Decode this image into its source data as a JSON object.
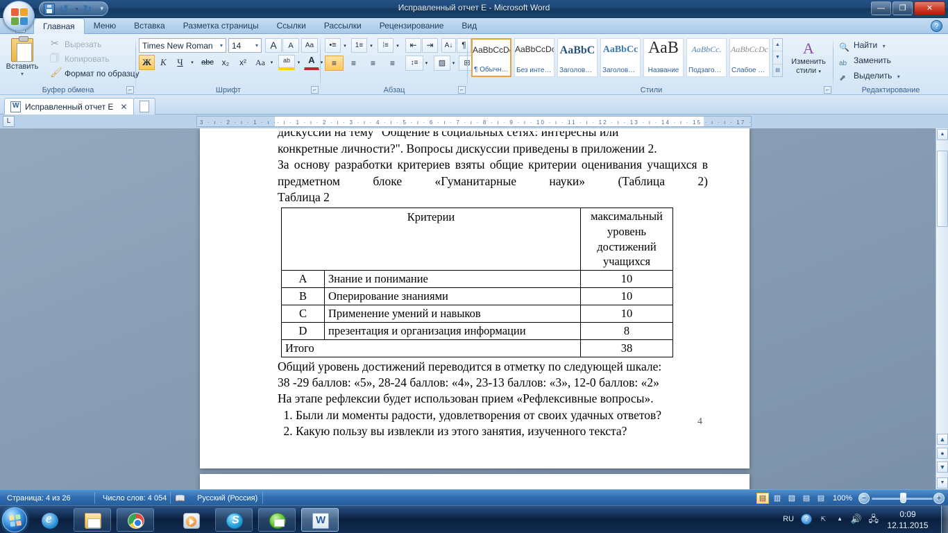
{
  "window": {
    "title": "Исправленный отчет Е - Microsoft Word",
    "minimize": "—",
    "maximize": "❐",
    "close": "✕"
  },
  "quick_access": {
    "save_icon": "save-icon",
    "undo_icon": "undo-icon",
    "redo_icon": "redo-icon",
    "customize_icon": "chevron-down-icon"
  },
  "ribbon": {
    "tabs": [
      {
        "label": "Главная",
        "active": true
      },
      {
        "label": "Меню",
        "active": false
      },
      {
        "label": "Вставка",
        "active": false
      },
      {
        "label": "Разметка страницы",
        "active": false
      },
      {
        "label": "Ссылки",
        "active": false
      },
      {
        "label": "Рассылки",
        "active": false
      },
      {
        "label": "Рецензирование",
        "active": false
      },
      {
        "label": "Вид",
        "active": false
      }
    ],
    "help_label": "?",
    "groups": {
      "clipboard": {
        "label": "Буфер обмена",
        "paste": "Вставить",
        "cut": "Вырезать",
        "copy": "Копировать",
        "format_painter": "Формат по образцу"
      },
      "font": {
        "label": "Шрифт",
        "font_name": "Times New Roman",
        "font_size": "14",
        "grow": "A",
        "shrink": "A",
        "clear_format": "Aa",
        "bold": "Ж",
        "italic": "К",
        "underline": "Ч",
        "strike": "abc",
        "subscript": "x₂",
        "superscript": "x²",
        "change_case": "Aa",
        "highlight": "ab",
        "font_color": "A"
      },
      "paragraph": {
        "label": "Абзац",
        "bullets": "•≡",
        "numbering": "1≡",
        "multilevel": "⁞≡",
        "decrease_indent": "⇤",
        "increase_indent": "⇥",
        "sort": "A↓",
        "show_marks": "¶",
        "align_left": "≡",
        "align_center": "≡",
        "align_right": "≡",
        "justify": "≡",
        "line_spacing": "↕≡",
        "shading": "▨",
        "borders": "⊞"
      },
      "styles": {
        "label": "Стили",
        "items": [
          {
            "sample": "AaBbCcDc",
            "name": "¶ Обычный",
            "selected": true
          },
          {
            "sample": "AaBbCcDc",
            "name": "Без интер…",
            "selected": false
          },
          {
            "sample": "AaBbC",
            "name": "Заголово…",
            "selected": false
          },
          {
            "sample": "AaBbCc",
            "name": "Заголово…",
            "selected": false
          },
          {
            "sample": "АаВ",
            "name": "Название",
            "selected": false
          },
          {
            "sample": "AaBbCc.",
            "name": "Подзагол…",
            "selected": false
          },
          {
            "sample": "AaBbCcDc",
            "name": "Слабое в…",
            "selected": false
          }
        ],
        "change_styles": "Изменить стили"
      },
      "editing": {
        "label": "Редактирование",
        "find": "Найти",
        "replace": "Заменить",
        "select": "Выделить"
      }
    }
  },
  "document_tabs": {
    "active_tab": "Исправленный отчет Е",
    "close_label": "✕"
  },
  "ruler": {
    "left_marks": "3 · ı · 2 · ı · 1 · ı ·",
    "right_marks": "· ı · 1 · ı · 2 · ı · 3 · ı · 4 · ı · 5 · ı · 6 · ı · 7 · ı · 8 · ı · 9 · ı · 10 · ı · 11 · ı · 12 · ı · 13 · ı · 14 · ı · 15 · ı · ı · 17 · ı ·"
  },
  "document": {
    "paragraph_clipped": "дискуссии на тему \"Общение в социальных сетях: интересны или",
    "paragraph_1": "конкретные личности?\". Вопросы дискуссии приведены в приложении 2.",
    "paragraph_2": "За основу разработки критериев взяты общие критерии оценивания учащихся в предметном блоке «Гуманитарные науки» (Таблица 2)",
    "table_caption": "Таблица 2",
    "table": {
      "header": {
        "criteria": "Критерии",
        "max_level": "максимальный уровень достижений учащихся"
      },
      "rows": [
        {
          "letter": "A",
          "criterion": "Знание и понимание",
          "value": "10"
        },
        {
          "letter": "B",
          "criterion": "Оперирование знаниями",
          "value": "10"
        },
        {
          "letter": "C",
          "criterion": "Применение умений и навыков",
          "value": "10"
        },
        {
          "letter": "D",
          "criterion": "презентация и организация информации",
          "value": "8"
        }
      ],
      "total": {
        "label": "Итого",
        "value": "38"
      }
    },
    "paragraph_3": "Общий уровень достижений переводится в отметку по следующей шкале:",
    "paragraph_4": "38 -29 баллов: «5», 28-24 баллов: «4», 23-13 баллов: «3», 12-0 баллов: «2»",
    "paragraph_5": "На этапе рефлексии будет использован прием «Рефлексивные вопросы».",
    "questions": [
      "Были ли моменты радости, удовлетворения от своих удачных ответов?",
      "Какую пользу вы извлекли из этого занятия, изученного текста?"
    ],
    "page_number": "4"
  },
  "status_bar": {
    "page": "Страница: 4 из 26",
    "words": "Число слов: 4 054",
    "proofing_icon": "spellcheck-icon",
    "language": "Русский (Россия)",
    "views": [
      {
        "icon": "print-layout-icon",
        "active": true
      },
      {
        "icon": "full-screen-reading-icon",
        "active": false
      },
      {
        "icon": "web-layout-icon",
        "active": false
      },
      {
        "icon": "outline-icon",
        "active": false
      },
      {
        "icon": "draft-icon",
        "active": false
      }
    ],
    "zoom_level": "100%",
    "zoom_out": "−",
    "zoom_in": "+"
  },
  "taskbar": {
    "start_label": "Пуск",
    "items": [
      {
        "name": "internet-explorer",
        "icon": "ie-icon"
      },
      {
        "name": "windows-explorer",
        "icon": "folder-icon"
      },
      {
        "name": "google-chrome",
        "icon": "chrome-icon"
      },
      {
        "name": "windows-media-player",
        "icon": "media-player-icon"
      },
      {
        "name": "skype",
        "icon": "skype-icon"
      },
      {
        "name": "icq",
        "icon": "icq-icon"
      },
      {
        "name": "microsoft-word",
        "icon": "word-icon"
      }
    ],
    "tray": {
      "language": "RU",
      "help_icon": "?",
      "show_hidden_icon": "▲",
      "volume_icon": "volume-icon",
      "network_icon": "network-icon",
      "time": "0:09",
      "date": "12.11.2015"
    }
  }
}
